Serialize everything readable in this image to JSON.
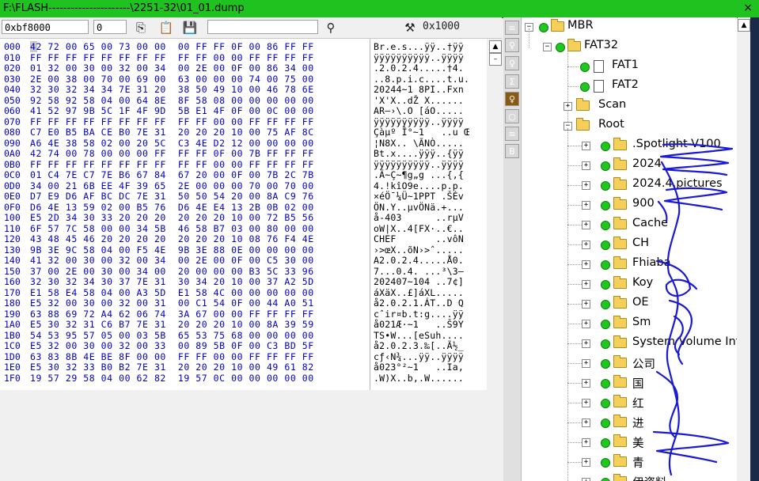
{
  "title": "F:\\FLASH----------------------\\2251-32\\01_01.dump",
  "close_glyph": "×",
  "toolbar": {
    "address": "0xbf8000",
    "field2": "0",
    "goto_value": "0x1000"
  },
  "hex_rows": [
    {
      "off": "000",
      "hex": "42 72 00 65 00 73 00 00  00 FF FF 0F 00 86 FF FF",
      "ascii": "Br.e.s...ÿÿ..†ÿÿ"
    },
    {
      "off": "010",
      "hex": "FF FF FF FF FF FF FF FF  FF FF 00 00 FF FF FF FF",
      "ascii": "ÿÿÿÿÿÿÿÿÿÿ..ÿÿÿÿ"
    },
    {
      "off": "020",
      "hex": "01 32 00 30 00 32 00 34  00 2E 00 0F 00 86 34 00",
      "ascii": ".2.0.2.4.....†4."
    },
    {
      "off": "030",
      "hex": "2E 00 38 00 70 00 69 00  63 00 00 00 74 00 75 00",
      "ascii": "..8.p.i.c....t.u."
    },
    {
      "off": "040",
      "hex": "32 30 32 34 34 7E 31 20  38 50 49 10 00 46 78 6E",
      "ascii": "20244~1 8PI..Fxn"
    },
    {
      "off": "050",
      "hex": "92 58 92 58 04 00 64 8E  8F 58 08 00 00 00 00 00",
      "ascii": "'X'X..dŽ X......"
    },
    {
      "off": "060",
      "hex": "41 52 97 9B 5C 1F 4F 9D  5B E1 4F 0F 00 0C 00 00",
      "ascii": "AR—›\\.O [áO....."
    },
    {
      "off": "070",
      "hex": "FF FF FF FF FF FF FF FF  FF FF 00 00 FF FF FF FF",
      "ascii": "ÿÿÿÿÿÿÿÿÿÿ..ÿÿÿÿ"
    },
    {
      "off": "080",
      "hex": "C7 E0 B5 BA CE B0 7E 31  20 20 20 10 00 75 AF 8C",
      "ascii": "Çàµº Î°~1   ..u Œ"
    },
    {
      "off": "090",
      "hex": "A6 4E 38 58 02 00 20 5C  C3 4E D2 12 00 00 00 00",
      "ascii": "¦N8X.. \\ÃNÒ....."
    },
    {
      "off": "0A0",
      "hex": "42 74 00 78 00 00 00 FF  FF FF 0F 00 7B FF FF FF",
      "ascii": "Bt.x....ÿÿÿ..{ÿÿ"
    },
    {
      "off": "0B0",
      "hex": "FF FF FF FF FF FF FF FF  FF FF 00 00 FF FF FF FF",
      "ascii": "ÿÿÿÿÿÿÿÿÿÿ..ÿÿÿÿ"
    },
    {
      "off": "0C0",
      "hex": "01 C4 7E C7 7E B6 67 84  67 20 00 0F 00 7B 2C 7B",
      "ascii": ".Ä~Ç~¶g„g ...{,{"
    },
    {
      "off": "0D0",
      "hex": "34 00 21 6B EE 4F 39 65  2E 00 00 00 70 00 70 00",
      "ascii": "4.!kîO9e....p.p."
    },
    {
      "off": "0E0",
      "hex": "D7 E9 D6 AF BC DC 7E 31  50 50 54 20 00 8A C9 76",
      "ascii": "×éÖ¯¼Ü~1PPT .ŠÉv"
    },
    {
      "off": "0F0",
      "hex": "D6 4E 13 59 02 00 B5 76  D6 4E E4 13 2B 0B 02 00",
      "ascii": "ÖN.Y..µvÖNä.+..."
    },
    {
      "off": "100",
      "hex": "E5 2D 34 30 33 20 20 20  20 20 20 10 00 72 B5 56",
      "ascii": "å-403      ..rµV"
    },
    {
      "off": "110",
      "hex": "6F 57 7C 58 00 00 34 5B  46 58 B7 03 00 80 00 00",
      "ascii": "oW|X..4[FX·..€.."
    },
    {
      "off": "120",
      "hex": "43 48 45 46 20 20 20 20  20 20 20 10 08 76 F4 4E",
      "ascii": "CHEF       ..vôN"
    },
    {
      "off": "130",
      "hex": "9B 3E 9C 58 04 00 F5 4E  9B 3E 88 0E 00 00 00 00",
      "ascii": "›>œX..õN›>ˆ....."
    },
    {
      "off": "140",
      "hex": "41 32 00 30 00 32 00 34  00 2E 00 0F 00 C5 30 00",
      "ascii": "A2.0.2.4.....Å0."
    },
    {
      "off": "150",
      "hex": "37 00 2E 00 30 00 34 00  20 00 00 00 B3 5C 33 96",
      "ascii": "7...0.4. ...³\\3–"
    },
    {
      "off": "160",
      "hex": "32 30 32 34 30 37 7E 31  30 34 20 10 00 37 A2 5D",
      "ascii": "202407~104 ..7¢]"
    },
    {
      "off": "170",
      "hex": "E1 58 E4 58 04 00 A3 5D  E1 58 4C 00 00 00 00 00",
      "ascii": "áXäX..£]áXL....."
    },
    {
      "off": "180",
      "hex": "E5 32 00 30 00 32 00 31  00 C1 54 0F 00 44 A0 51",
      "ascii": "å2.0.2.1.ÁT..D Q"
    },
    {
      "off": "190",
      "hex": "63 88 69 72 A4 62 06 74  3A 67 00 00 FF FF FF FF",
      "ascii": "cˆir¤b.t:g....ÿÿ"
    },
    {
      "off": "1A0",
      "hex": "E5 30 32 31 C6 B7 7E 31  20 20 20 10 00 8A 39 59",
      "ascii": "å021Æ·~1   ..Š9Y"
    },
    {
      "off": "1B0",
      "hex": "54 53 95 57 05 00 03 5B  65 53 75 68 00 00 00 00",
      "ascii": "TS•W...[eSuh...."
    },
    {
      "off": "1C0",
      "hex": "E5 32 00 30 00 32 00 33  00 89 5B 0F 00 C3 BD 5F",
      "ascii": "å2.0.2.3.‰[..Ã½_"
    },
    {
      "off": "1D0",
      "hex": "63 83 8B 4E BE 8F 00 00  FF FF 00 00 FF FF FF FF",
      "ascii": "cƒ‹N¾...ÿÿ..ÿÿÿÿ"
    },
    {
      "off": "1E0",
      "hex": "E5 30 32 33 B0 B2 7E 31  20 20 20 10 00 49 61 82",
      "ascii": "å023°²~1   ..Ia‚"
    },
    {
      "off": "1F0",
      "hex": "19 57 29 58 04 00 62 82  19 57 0C 00 00 00 00 00",
      "ascii": ".W)X..b‚.W......"
    }
  ],
  "tree": {
    "mbr": "MBR",
    "fat32": "FAT32",
    "fat1": "FAT1",
    "fat2": "FAT2",
    "scan": "Scan",
    "root": "Root",
    "children": [
      ".Spotlight-V100",
      "2024",
      "2024.4.pictures",
      "900",
      "Cache",
      "CH",
      "Fhiaba",
      "Koy",
      "OE",
      "Sm",
      "System Volume Information",
      "公司",
      "国",
      "红",
      "进",
      "美",
      "青",
      "伊资料"
    ]
  },
  "sidebar_buttons": [
    "≡",
    "♀",
    "♀",
    "Σ",
    "♀",
    "○",
    "≡",
    "B"
  ]
}
